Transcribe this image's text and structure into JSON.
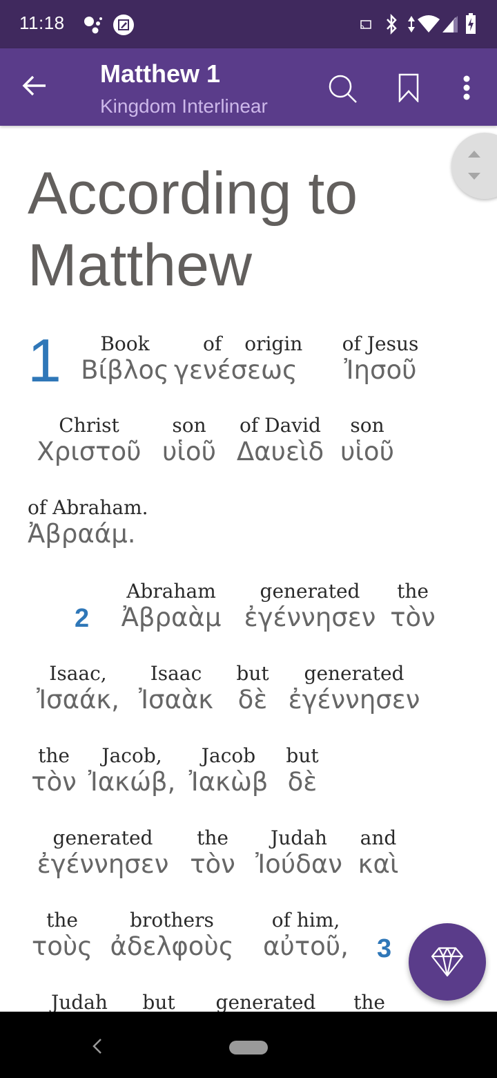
{
  "status_bar": {
    "time": "11:18",
    "left_icons": [
      "assistant-icon",
      "screenshot-edit-icon"
    ],
    "right_icons": [
      "cast-icon",
      "bluetooth-icon",
      "data-arrows-icon",
      "wifi-icon",
      "cell-signal-icon",
      "battery-charging-icon"
    ]
  },
  "app_bar": {
    "title": "Matthew 1",
    "subtitle": "Kingdom Interlinear",
    "actions": [
      "search",
      "bookmark",
      "more-options"
    ]
  },
  "book_title": "According to Matthew",
  "verses": {
    "v1_number": "1",
    "v2_number": "2",
    "v3_number": "3"
  },
  "lines": [
    {
      "words": [
        {
          "en": "Book",
          "gr": "Βίβλος"
        },
        {
          "en": "of",
          "gr": "γενέσεως"
        },
        {
          "en": "origin",
          "gr": ""
        },
        {
          "en": "of Jesus",
          "gr": "Ἰησοῦ"
        }
      ]
    },
    {
      "words": [
        {
          "en": "Christ",
          "gr": "Χριστοῦ"
        },
        {
          "en": "son",
          "gr": "υἱοῦ"
        },
        {
          "en": "of David",
          "gr": "Δαυεὶδ"
        },
        {
          "en": "son",
          "gr": "υἱοῦ"
        }
      ]
    },
    {
      "words": [
        {
          "en": "of Abraham.",
          "gr": "Ἀβραάμ."
        }
      ]
    },
    {
      "words": [
        {
          "en": "Abraham",
          "gr": "Ἀβραὰμ"
        },
        {
          "en": "generated",
          "gr": "ἐγέννησεν"
        },
        {
          "en": "the",
          "gr": "τὸν"
        }
      ]
    },
    {
      "words": [
        {
          "en": "Isaac,",
          "gr": "Ἰσαάκ,"
        },
        {
          "en": "Isaac",
          "gr": "Ἰσαὰκ"
        },
        {
          "en": "but",
          "gr": "δὲ"
        },
        {
          "en": "generated",
          "gr": "ἐγέννησεν"
        }
      ]
    },
    {
      "words": [
        {
          "en": "the",
          "gr": "τὸν"
        },
        {
          "en": "Jacob,",
          "gr": "Ἰακώβ,"
        },
        {
          "en": "Jacob",
          "gr": "Ἰακὼβ"
        },
        {
          "en": "but",
          "gr": "δὲ"
        }
      ]
    },
    {
      "words": [
        {
          "en": "generated",
          "gr": "ἐγέννησεν"
        },
        {
          "en": "the",
          "gr": "τὸν"
        },
        {
          "en": "Judah",
          "gr": "Ἰούδαν"
        },
        {
          "en": "and",
          "gr": "καὶ"
        }
      ]
    },
    {
      "words": [
        {
          "en": "the",
          "gr": "τοὺς"
        },
        {
          "en": "brothers",
          "gr": "ἀδελφοὺς"
        },
        {
          "en": "of him,",
          "gr": "αὐτοῦ,"
        }
      ]
    },
    {
      "words": [
        {
          "en": "Judah",
          "gr": ""
        },
        {
          "en": "but",
          "gr": ""
        },
        {
          "en": "generated",
          "gr": ""
        },
        {
          "en": "the",
          "gr": ""
        }
      ]
    }
  ],
  "colors": {
    "status_bar": "#40295e",
    "app_bar": "#5a3c8a",
    "subtitle": "#cdb8ea",
    "verse_number": "#2f77b8",
    "title_text": "#625f5d",
    "greek_text": "#666666",
    "english_text": "#2a2a2a"
  },
  "fab": {
    "icon": "diamond-icon"
  },
  "nav_bar": {
    "buttons": [
      "back",
      "home"
    ]
  }
}
